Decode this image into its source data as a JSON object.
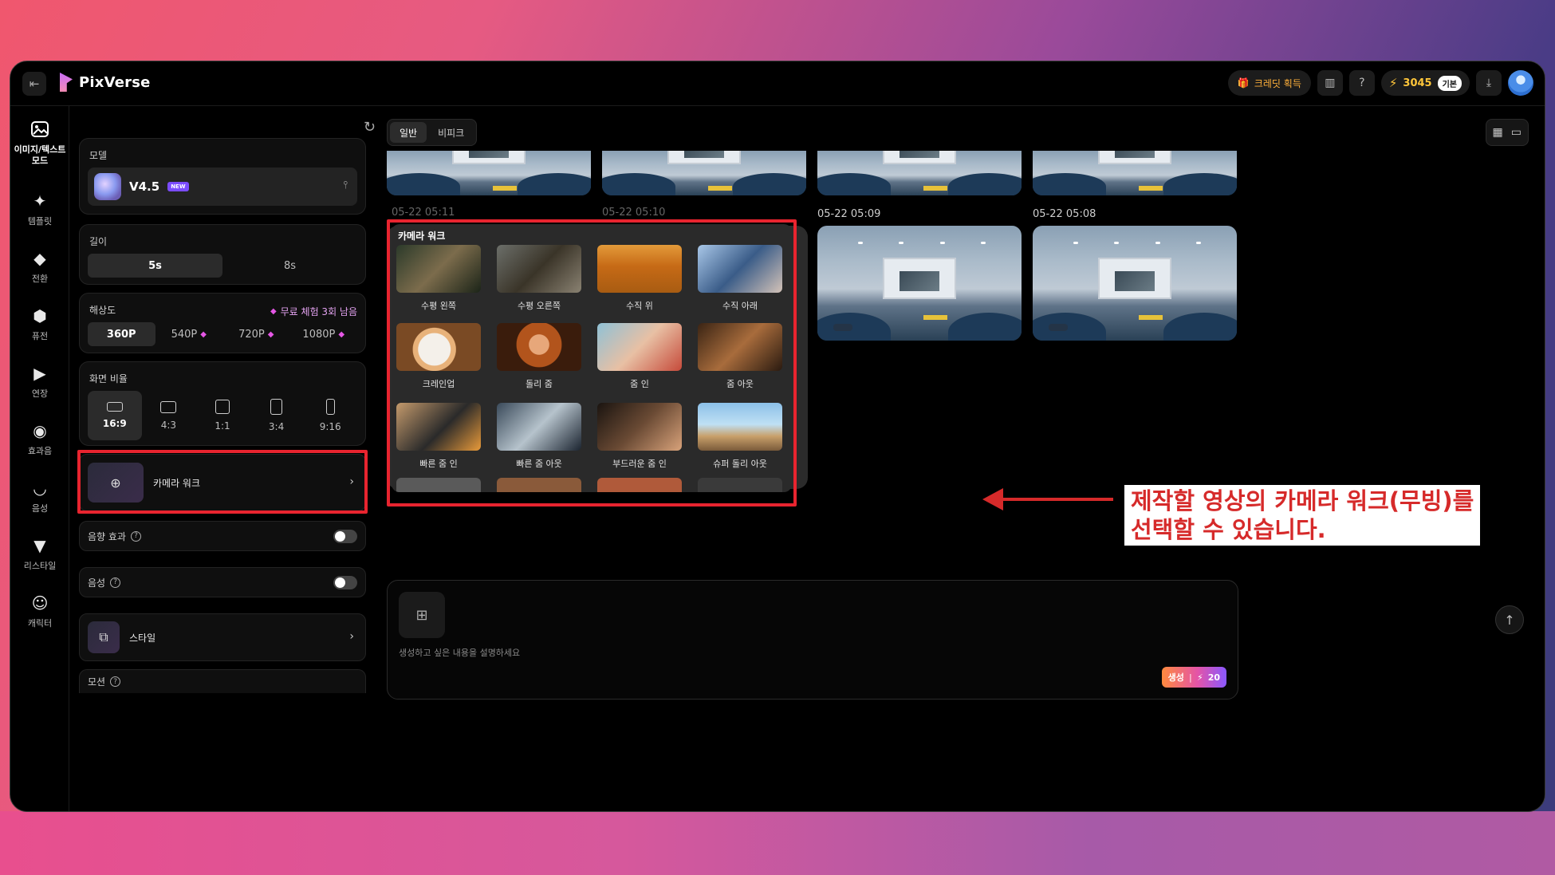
{
  "app": {
    "name": "PixVerse"
  },
  "topbar": {
    "get_credits": "크레딧 획득",
    "credits": "3045",
    "plan": "기본"
  },
  "sidebar": {
    "items": [
      {
        "label": "이미지/텍스트 모드",
        "icon": "image-icon",
        "active": true
      },
      {
        "label": "템플릿",
        "icon": "sparkle-icon"
      },
      {
        "label": "전환",
        "icon": "transition-icon"
      },
      {
        "label": "퓨전",
        "icon": "cube-icon"
      },
      {
        "label": "연장",
        "icon": "extend-icon"
      },
      {
        "label": "효과음",
        "icon": "soundwave-icon"
      },
      {
        "label": "음성",
        "icon": "lips-icon"
      },
      {
        "label": "리스타일",
        "icon": "brush-icon"
      },
      {
        "label": "캐릭터",
        "icon": "smile-icon"
      }
    ]
  },
  "panel": {
    "model": {
      "title": "모델",
      "name": "V4.5",
      "badge": "NEW"
    },
    "duration": {
      "title": "길이",
      "options": [
        "5s",
        "8s"
      ],
      "selected": "5s"
    },
    "resolution": {
      "title": "해상도",
      "free_trial": "무료 체험 3회 남음",
      "options": [
        "360P",
        "540P",
        "720P",
        "1080P"
      ],
      "selected": "360P"
    },
    "aspect": {
      "title": "화면 비율",
      "options": [
        "16:9",
        "4:3",
        "1:1",
        "3:4",
        "9:16"
      ],
      "selected": "16:9"
    },
    "camera_work": {
      "label": "카메라 워크"
    },
    "sound_effect": {
      "label": "음향 효과"
    },
    "voice": {
      "label": "음성"
    },
    "style": {
      "label": "스타일"
    },
    "motion": {
      "label": "모션"
    }
  },
  "main": {
    "tabs": [
      "일반",
      "비피크"
    ],
    "selected_tab": "일반",
    "timestamps": [
      "05-22 05:11",
      "05-22 05:10",
      "05-22 05:09",
      "05-22 05:08"
    ],
    "camera_dropdown": {
      "title": "카메라 워크",
      "items": [
        {
          "label": "수평 왼쪽"
        },
        {
          "label": "수평 오른쪽"
        },
        {
          "label": "수직 위"
        },
        {
          "label": "수직 아래"
        },
        {
          "label": "크레인업"
        },
        {
          "label": "돌리 줌"
        },
        {
          "label": "줌 인"
        },
        {
          "label": "줌 아웃"
        },
        {
          "label": "빠른 줌 인"
        },
        {
          "label": "빠른 줌 아웃"
        },
        {
          "label": "부드러운 줌 인"
        },
        {
          "label": "슈퍼 돌리 아웃"
        }
      ]
    },
    "prompt_placeholder": "생성하고 싶은 내용을 설명하세요",
    "generate": {
      "label": "생성",
      "cost": "20"
    }
  },
  "annotation": {
    "line1": "제작할 영상의 카메라 워크(무빙)를",
    "line2": "선택할 수 있습니다."
  },
  "colors": {
    "highlight": "#e8242f",
    "credit": "#ffc63a"
  }
}
